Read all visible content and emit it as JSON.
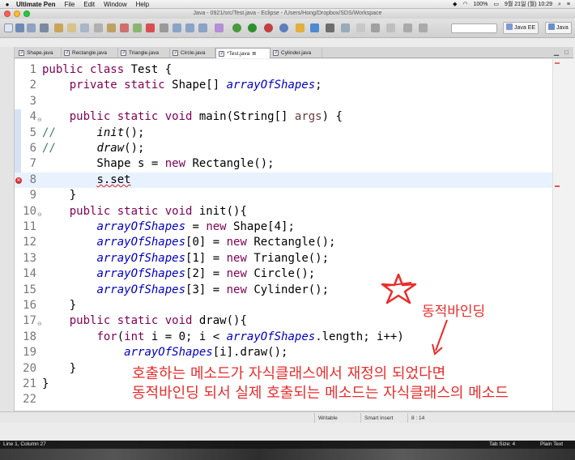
{
  "menubar": {
    "app_name": "Ultimate Pen",
    "items": [
      "File",
      "Edit",
      "Window",
      "Help"
    ],
    "battery": "100%",
    "datetime": "9월 21일 (월)  10:29"
  },
  "window": {
    "title": "Java - 0921/src/Test.java - Eclipse - /Users/Hong/Dropbox/SDS/Workspace"
  },
  "perspectives": [
    "Java EE",
    "Java"
  ],
  "editor_tabs": [
    {
      "label": "Shape.java",
      "active": false
    },
    {
      "label": "Rectangle.java",
      "active": false
    },
    {
      "label": "Triangle.java",
      "active": false
    },
    {
      "label": "Circle.java",
      "active": false
    },
    {
      "label": "*Test.java",
      "active": true
    },
    {
      "label": "Cylinder.java",
      "active": false
    }
  ],
  "tab_close_glyph": "⊠",
  "code": {
    "lines": [
      {
        "n": "1",
        "segs": [
          [
            "kw",
            "public class "
          ],
          [
            "",
            "Test {"
          ]
        ]
      },
      {
        "n": "2",
        "segs": [
          [
            "",
            "    "
          ],
          [
            "kw",
            "private static "
          ],
          [
            "",
            "Shape[] "
          ],
          [
            "fld",
            "arrayOfShapes"
          ],
          [
            "",
            ";"
          ]
        ]
      },
      {
        "n": "3",
        "segs": [
          [
            "",
            ""
          ]
        ]
      },
      {
        "n": "4",
        "fold": true,
        "segs": [
          [
            "",
            "    "
          ],
          [
            "kw",
            "public static void "
          ],
          [
            "",
            "main(String[] "
          ],
          [
            "prm",
            "args"
          ],
          [
            "",
            ") {"
          ]
        ]
      },
      {
        "n": "5",
        "segs": [
          [
            "cmt",
            "//      "
          ],
          [
            "mth",
            "init"
          ],
          [
            "",
            "();"
          ]
        ]
      },
      {
        "n": "6",
        "segs": [
          [
            "cmt",
            "//      "
          ],
          [
            "mth",
            "draw"
          ],
          [
            "",
            "();"
          ]
        ]
      },
      {
        "n": "7",
        "segs": [
          [
            "",
            "        Shape s = "
          ],
          [
            "kw",
            "new "
          ],
          [
            "",
            "Rectangle();"
          ]
        ]
      },
      {
        "n": "8",
        "current": true,
        "error": true,
        "segs": [
          [
            "",
            "        "
          ],
          [
            "err",
            "s.set"
          ]
        ]
      },
      {
        "n": "9",
        "segs": [
          [
            "",
            "    }"
          ]
        ]
      },
      {
        "n": "10",
        "fold": true,
        "segs": [
          [
            "",
            "    "
          ],
          [
            "kw",
            "public static void "
          ],
          [
            "",
            "init(){"
          ]
        ]
      },
      {
        "n": "11",
        "segs": [
          [
            "",
            "        "
          ],
          [
            "fld",
            "arrayOfShapes"
          ],
          [
            "",
            " = "
          ],
          [
            "kw",
            "new "
          ],
          [
            "",
            "Shape[4];"
          ]
        ]
      },
      {
        "n": "12",
        "segs": [
          [
            "",
            "        "
          ],
          [
            "fld",
            "arrayOfShapes"
          ],
          [
            "",
            "[0] = "
          ],
          [
            "kw",
            "new "
          ],
          [
            "",
            "Rectangle();"
          ]
        ]
      },
      {
        "n": "13",
        "segs": [
          [
            "",
            "        "
          ],
          [
            "fld",
            "arrayOfShapes"
          ],
          [
            "",
            "[1] = "
          ],
          [
            "kw",
            "new "
          ],
          [
            "",
            "Triangle();"
          ]
        ]
      },
      {
        "n": "14",
        "segs": [
          [
            "",
            "        "
          ],
          [
            "fld",
            "arrayOfShapes"
          ],
          [
            "",
            "[2] = "
          ],
          [
            "kw",
            "new "
          ],
          [
            "",
            "Circle();"
          ]
        ]
      },
      {
        "n": "15",
        "segs": [
          [
            "",
            "        "
          ],
          [
            "fld",
            "arrayOfShapes"
          ],
          [
            "",
            "[3] = "
          ],
          [
            "kw",
            "new "
          ],
          [
            "",
            "Cylinder();"
          ]
        ]
      },
      {
        "n": "16",
        "segs": [
          [
            "",
            "    }"
          ]
        ]
      },
      {
        "n": "17",
        "fold": true,
        "segs": [
          [
            "",
            "    "
          ],
          [
            "kw",
            "public static void "
          ],
          [
            "",
            "draw(){"
          ]
        ]
      },
      {
        "n": "18",
        "segs": [
          [
            "",
            "        "
          ],
          [
            "kw",
            "for"
          ],
          [
            "",
            "("
          ],
          [
            "kw",
            "int "
          ],
          [
            "",
            "i = 0; i < "
          ],
          [
            "fld",
            "arrayOfShapes"
          ],
          [
            "",
            ".length; i++)"
          ]
        ]
      },
      {
        "n": "19",
        "segs": [
          [
            "",
            "            "
          ],
          [
            "fld",
            "arrayOfShapes"
          ],
          [
            "",
            "[i].draw();"
          ]
        ]
      },
      {
        "n": "20",
        "segs": [
          [
            "",
            "    }"
          ]
        ]
      },
      {
        "n": "21",
        "segs": [
          [
            "",
            "}"
          ]
        ]
      },
      {
        "n": "22",
        "segs": [
          [
            "",
            ""
          ]
        ]
      }
    ]
  },
  "annotations": {
    "title": "동적바인딩",
    "line1": "호출하는 메소드가 자식클래스에서 재정의 되었다면",
    "line2": "동적바인딩 되서 실제 호출되는 메소드는 자식클래스의 메소드",
    "color": "#ea2c2c"
  },
  "editor_status": {
    "mode": "Writable",
    "insert": "Smart Insert",
    "position": "8 : 14"
  },
  "bottom_strip": {
    "cursor": "Line 1, Column 27",
    "tab_size": "Tab Size: 4",
    "syntax": "Plain Text"
  },
  "colors": {
    "keyword": "#7f0055",
    "field": "#0000c0",
    "comment": "#3f7f5f",
    "current_line": "#e8f2fe"
  }
}
